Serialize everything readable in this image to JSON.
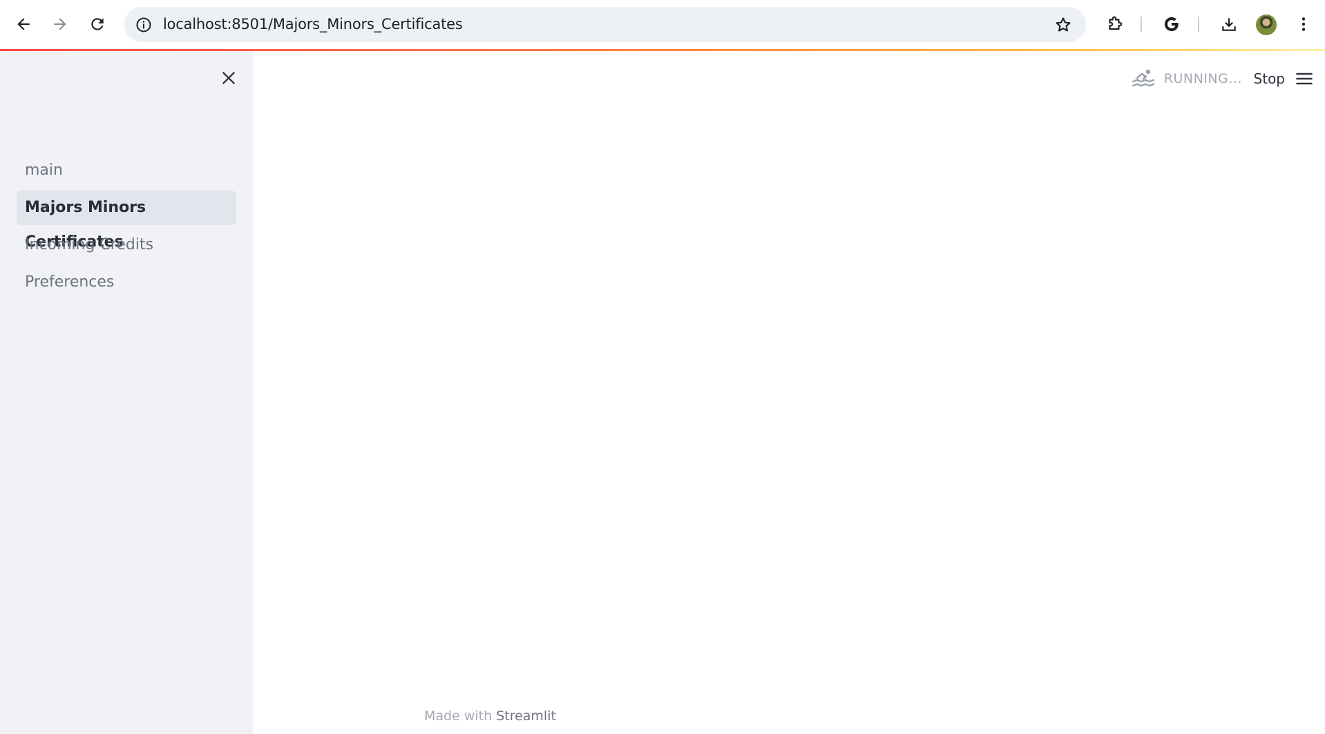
{
  "browser": {
    "url": "localhost:8501/Majors_Minors_Certificates"
  },
  "sidebar": {
    "items": [
      {
        "label": "main",
        "active": false
      },
      {
        "label": "Majors Minors Certificates",
        "active": true
      },
      {
        "label": "Incoming Credits",
        "active": false
      },
      {
        "label": "Preferences",
        "active": false
      }
    ]
  },
  "header": {
    "status_text": "RUNNING...",
    "stop_label": "Stop"
  },
  "footer": {
    "prefix": "Made with",
    "brand": "Streamlit"
  },
  "colors": {
    "accent": "#ff4b4b",
    "sidebar_bg": "#f0f2f6",
    "active_item_bg": "#e2e5ec",
    "muted_text": "#a3a8b4"
  },
  "icons": {
    "back": "back-arrow-icon",
    "forward": "forward-arrow-icon",
    "reload": "reload-icon",
    "site_info": "info-icon",
    "bookmark": "star-icon",
    "extensions": "puzzle-icon",
    "google": "google-g-icon",
    "downloads": "download-icon",
    "menu": "kebab-menu-icon",
    "sidebar_close": "close-icon",
    "running": "swimmer-icon",
    "app_menu": "hamburger-icon"
  }
}
